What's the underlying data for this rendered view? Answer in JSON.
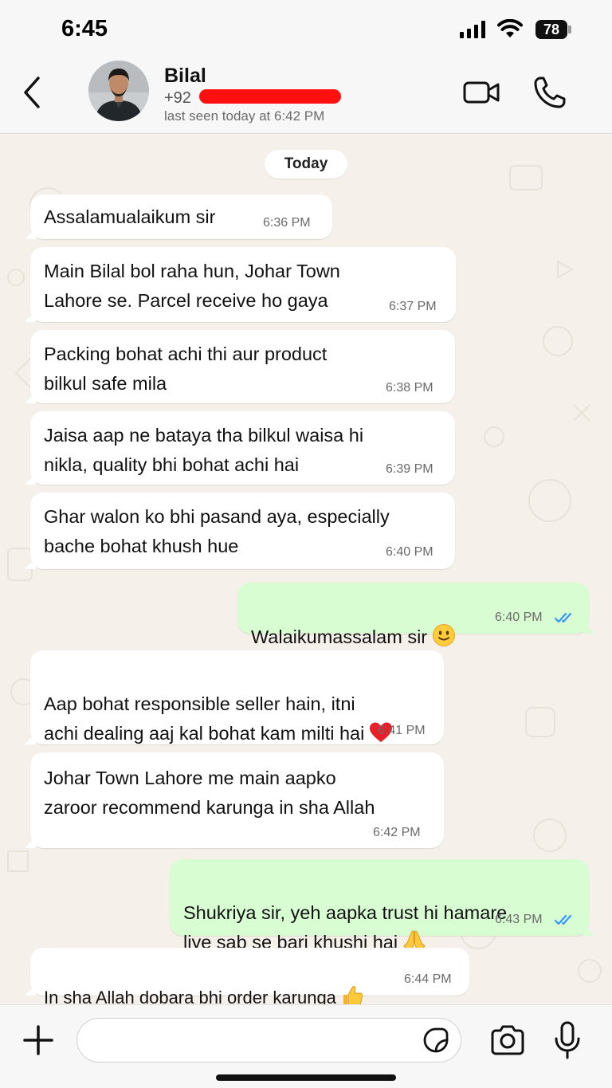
{
  "status_bar": {
    "time": "6:45",
    "battery": "78"
  },
  "header": {
    "name": "Bilal",
    "phone": "+92",
    "last_seen": "last seen today at 6:42 PM"
  },
  "chat": {
    "date_label": "Today",
    "messages": [
      {
        "direction": "incoming",
        "text": "Assalamualaikum sir",
        "time": "6:36 PM"
      },
      {
        "direction": "incoming",
        "text": "Main Bilal bol raha hun, Johar Town\nLahore se. Parcel receive ho gaya",
        "time": "6:37 PM"
      },
      {
        "direction": "incoming",
        "text": "Packing bohat achi thi aur product\nbilkul safe mila",
        "time": "6:38 PM"
      },
      {
        "direction": "incoming",
        "text": "Jaisa aap ne bataya tha bilkul waisa hi\nnikla, quality bhi bohat achi hai",
        "time": "6:39 PM"
      },
      {
        "direction": "incoming",
        "text": "Ghar walon ko bhi pasand aya, especially\nbache bohat khush hue",
        "time": "6:40 PM"
      },
      {
        "direction": "outgoing",
        "text": "Walaikumassalam sir",
        "emoji": "slightly-smiling-face",
        "time": "6:40 PM",
        "status": "read"
      },
      {
        "direction": "incoming",
        "text": "Aap bohat responsible seller hain, itni\nachi dealing aaj kal bohat kam milti hai",
        "emoji": "red-heart",
        "time": "6:41 PM"
      },
      {
        "direction": "incoming",
        "text": "Johar Town Lahore me main aapko\nzaroor recommend karunga in sha Allah",
        "time": "6:42 PM"
      },
      {
        "direction": "outgoing",
        "text": "Shukriya sir, yeh aapka trust hi hamare\nliye sab se bari khushi hai",
        "emoji": "folded-hands",
        "time": "6:43 PM",
        "status": "read"
      },
      {
        "direction": "incoming",
        "text": "In sha Allah dobara bhi order karunga",
        "emoji": "thumbs-up",
        "time": "6:44 PM"
      }
    ]
  },
  "composer": {
    "placeholder": "",
    "value": ""
  },
  "colors": {
    "incoming_bubble": "#ffffff",
    "outgoing_bubble": "#d9fdd3",
    "read_ticks": "#3497f9",
    "chat_background": "#f5f1ea",
    "redaction": "#ff1010"
  },
  "icons": {
    "back": "chevron-left-icon",
    "video": "video-camera-icon",
    "call": "phone-icon",
    "attach": "plus-icon",
    "sticker": "sticker-icon",
    "camera": "camera-icon",
    "mic": "microphone-icon"
  }
}
